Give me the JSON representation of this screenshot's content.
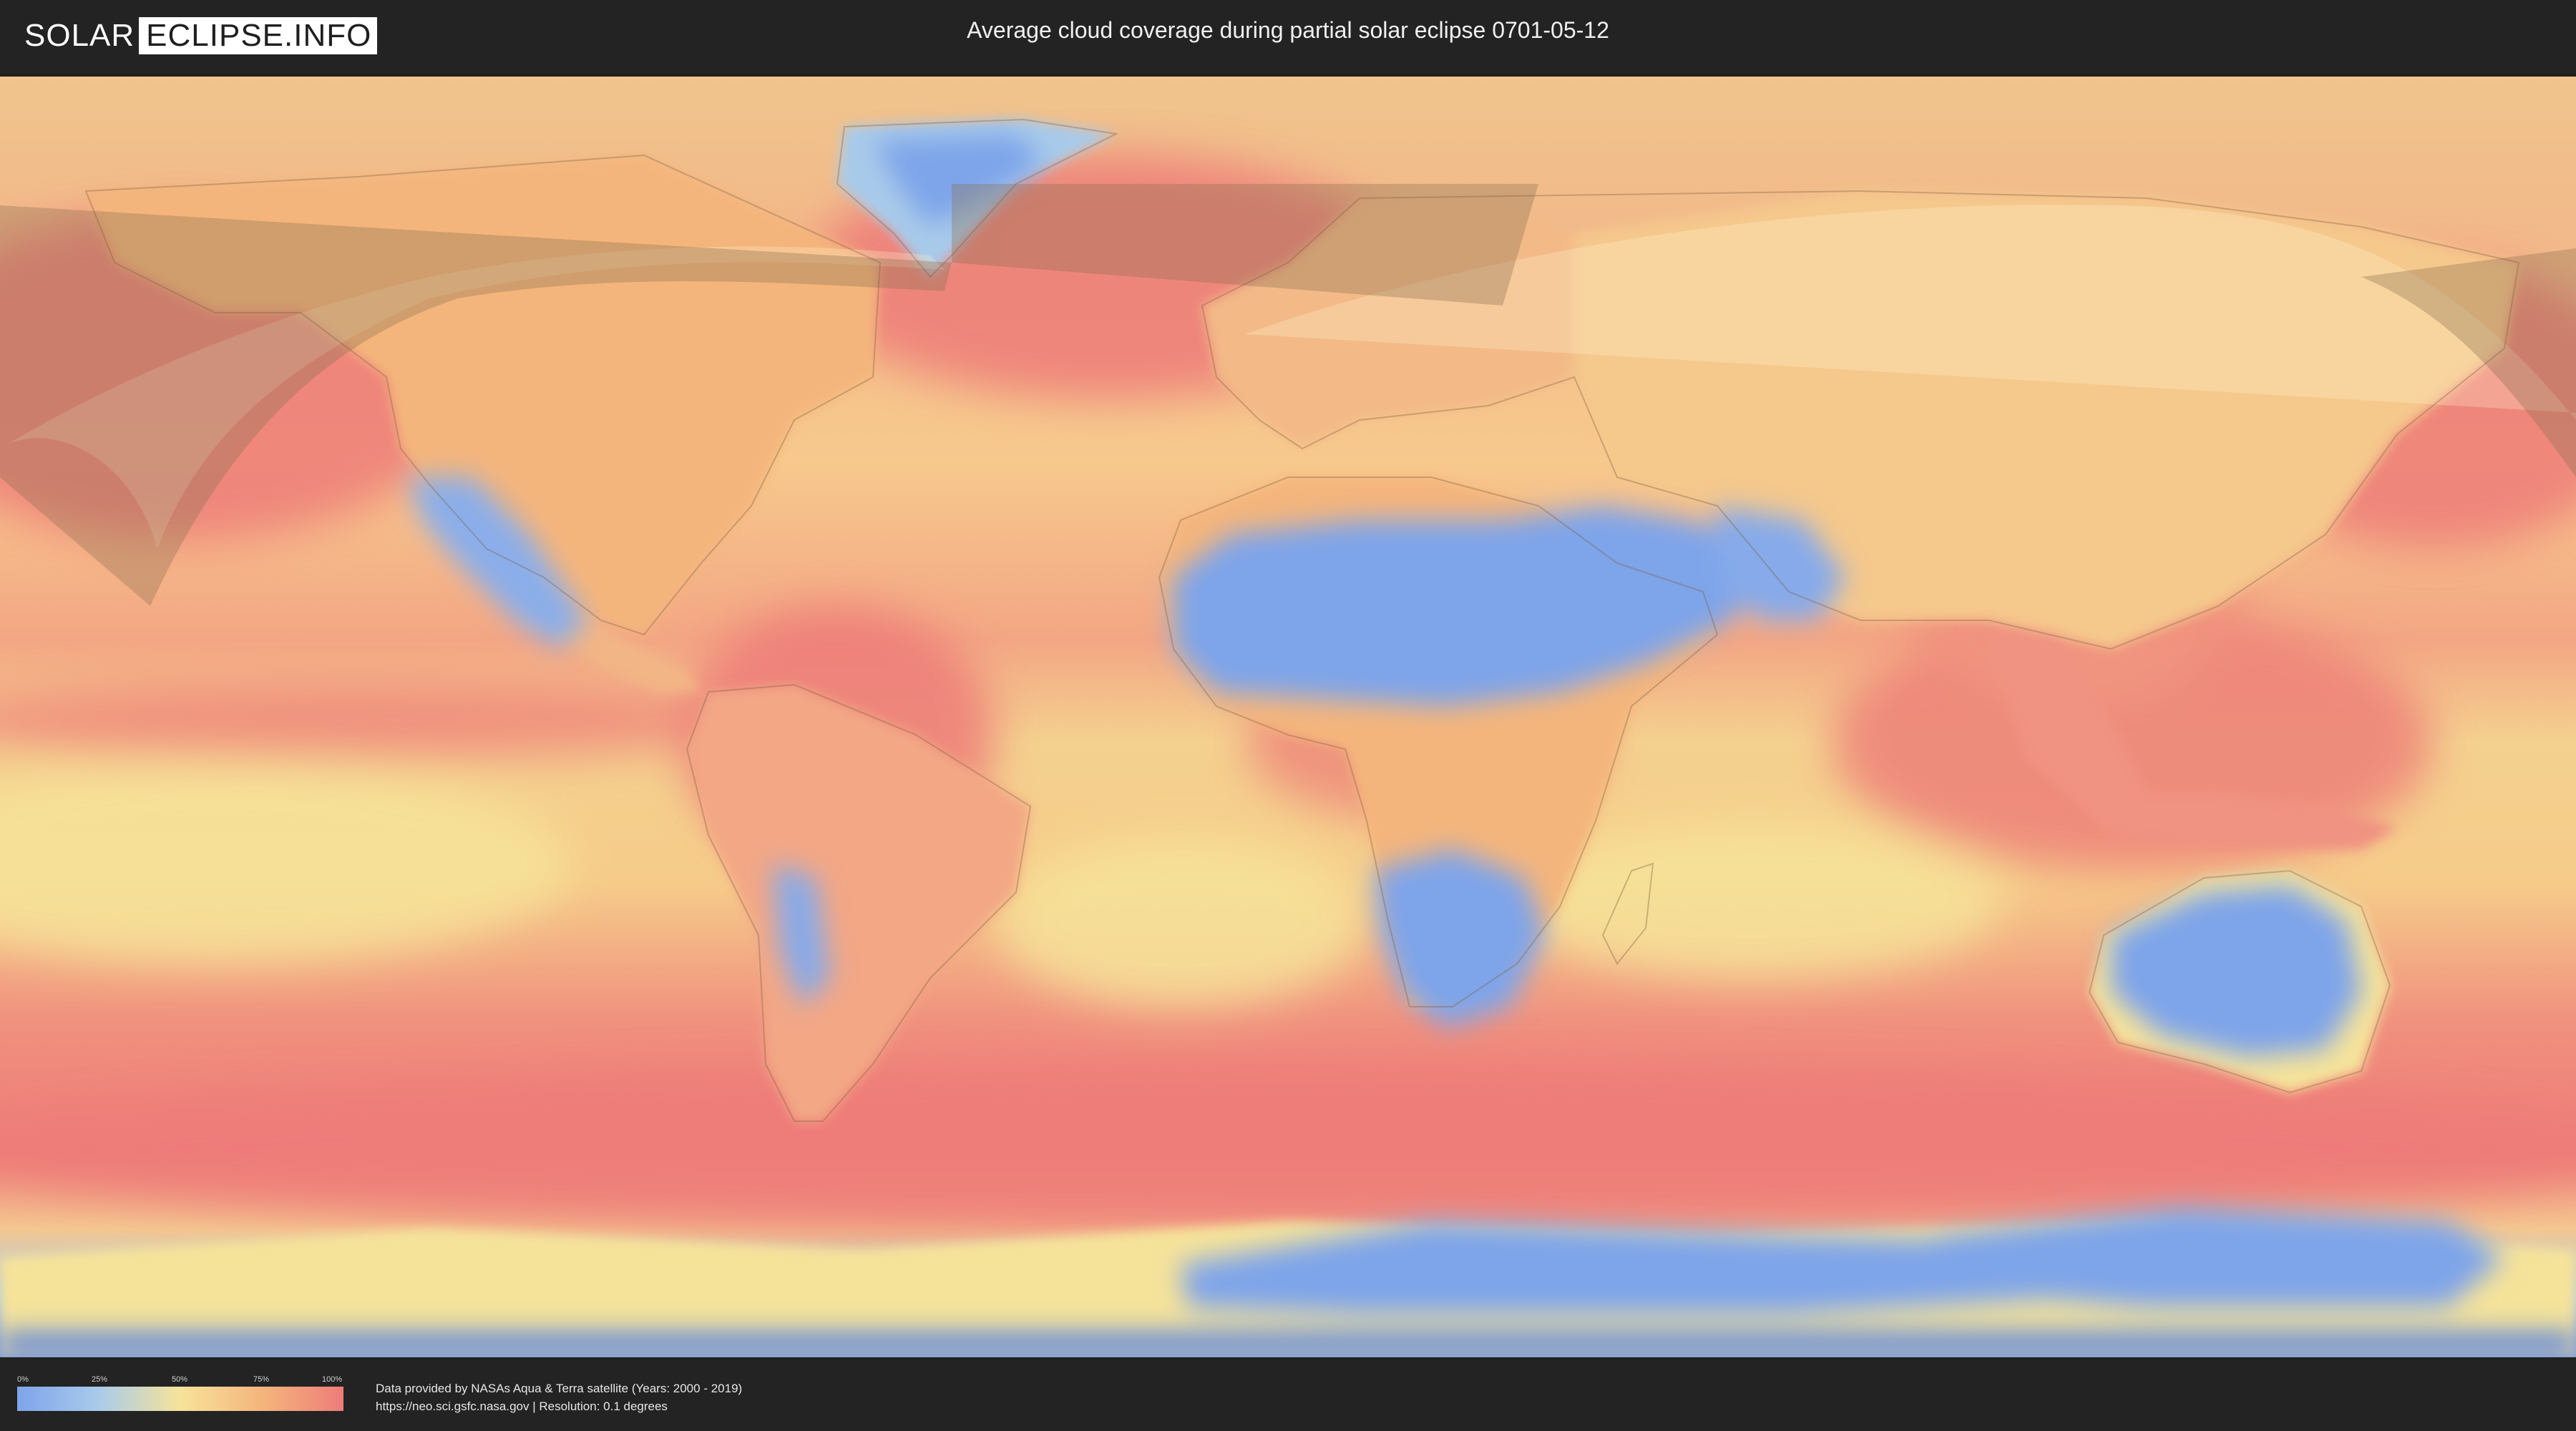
{
  "header": {
    "logo_left": "SOLAR",
    "logo_right": "ECLIPSE.INFO",
    "title": "Average cloud coverage during partial solar eclipse 0701-05-12"
  },
  "legend": {
    "ticks": [
      "0%",
      "25%",
      "50%",
      "75%",
      "100%"
    ],
    "colors": [
      "#7ea4ea",
      "#a9cbea",
      "#f6e39a",
      "#f4b57c",
      "#ee7c79"
    ]
  },
  "credits": {
    "line1": "Data provided by NASAs Aqua & Terra satellite (Years: 2000 - 2019)",
    "line2": "https://neo.sci.gsfc.nasa.gov | Resolution: 0.1 degrees"
  },
  "map": {
    "projection": "equirectangular",
    "colors": {
      "clear": "#7ea4ea",
      "light": "#a9cbea",
      "mid": "#f6e39a",
      "high": "#f4b57c",
      "full": "#ee7c79",
      "eclipse_overlay": "#fff5d0",
      "eclipse_shade": "#6e6048"
    }
  }
}
